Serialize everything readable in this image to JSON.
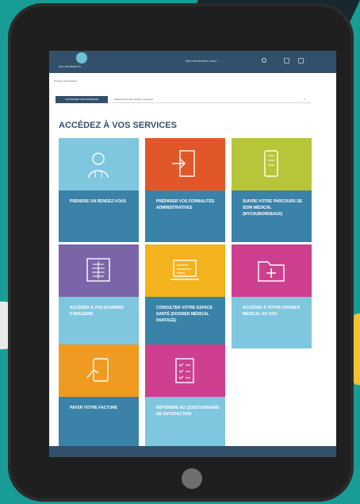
{
  "header": {
    "logo_text": "chu-bordeaux.fr",
    "search_placeholder": "Que recherchez-vous ?"
  },
  "breadcrumb": "Accueil / Vos services",
  "toolbar": {
    "category_button": "CHOISISSEZ UNE RUBRIQUE",
    "dropdown_value": "Sélectionnez dans la liste ci-dessous"
  },
  "page": {
    "title": "ACCÉDEZ À VOS SERVICES"
  },
  "tiles": [
    {
      "label": "PRENDRE UN RENDEZ-VOUS",
      "icon": "doctor-icon",
      "top_color": "#7fc6df",
      "bottom_color": "#3a82a8"
    },
    {
      "label": "PRÉPARER VOS FORMALITÉS ADMINISTRATIVES",
      "icon": "door-exit-icon",
      "top_color": "#e1572a",
      "bottom_color": "#3a82a8"
    },
    {
      "label": "SUIVRE VOTRE PARCOURS DE SOIN MÉDICAL (MYCHUBORDEAUX)",
      "icon": "phone-app-icon",
      "top_color": "#b7c53a",
      "bottom_color": "#3a82a8"
    },
    {
      "label": "ACCÉDER À VOS EXAMENS D'IMAGERIE",
      "icon": "xray-icon",
      "top_color": "#7c64a9",
      "bottom_color": "#7fc6df"
    },
    {
      "label": "CONSULTER VOTRE ESPACE SANTÉ (DOSSIER MÉDICAL PARTAGÉ)",
      "icon": "laptop-icon",
      "top_color": "#f2b31c",
      "bottom_color": "#3a82a8"
    },
    {
      "label": "ACCÉDER À VOTRE DOSSIER MÉDICAL DU CHU",
      "icon": "medical-folder-icon",
      "top_color": "#cf3f8f",
      "bottom_color": "#7fc6df"
    },
    {
      "label": "PAYER VOTRE FACTURE",
      "icon": "payment-card-icon",
      "top_color": "#ef9a20",
      "bottom_color": "#3a82a8"
    },
    {
      "label": "RÉPONDRE AU QUESTIONNAIRE DE SATISFACTION",
      "icon": "checklist-icon",
      "top_color": "#cf3f8f",
      "bottom_color": "#7fc6df"
    }
  ]
}
